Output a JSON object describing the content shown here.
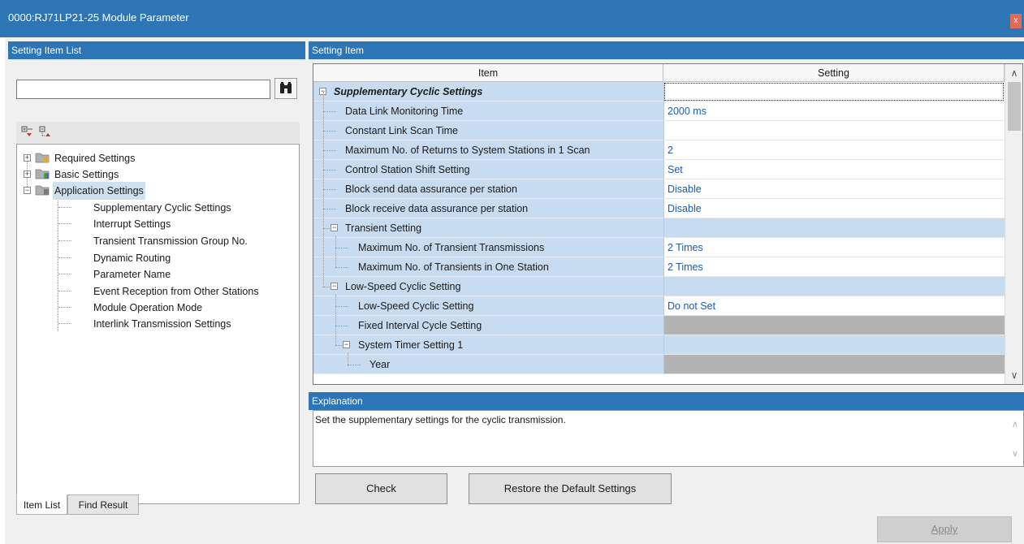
{
  "window": {
    "title": "0000:RJ71LP21-25 Module Parameter",
    "close_label": "x"
  },
  "left_panel": {
    "header": "Setting Item List",
    "search": {
      "value": "",
      "placeholder": ""
    },
    "tree": {
      "required": "Required Settings",
      "basic": "Basic Settings",
      "application": "Application Settings",
      "children": [
        "Supplementary Cyclic Settings",
        "Interrupt Settings",
        "Transient Transmission Group No.",
        "Dynamic Routing",
        "Parameter Name",
        "Event Reception from Other Stations",
        "Module Operation Mode",
        "Interlink Transmission Settings"
      ]
    },
    "tabs": [
      "Item List",
      "Find Result"
    ]
  },
  "grid_panel": {
    "header": "Setting Item",
    "columns": {
      "item": "Item",
      "setting": "Setting"
    },
    "rows": [
      {
        "item": "Supplementary Cyclic Settings",
        "setting": ""
      },
      {
        "item": "Data Link Monitoring Time",
        "setting": "2000 ms"
      },
      {
        "item": "Constant Link Scan Time",
        "setting": ""
      },
      {
        "item": "Maximum No. of Returns to System Stations in 1 Scan",
        "setting": "2"
      },
      {
        "item": "Control Station Shift Setting",
        "setting": "Set"
      },
      {
        "item": "Block send data assurance per station",
        "setting": "Disable"
      },
      {
        "item": "Block receive data assurance per station",
        "setting": "Disable"
      },
      {
        "item": "Transient Setting",
        "setting": ""
      },
      {
        "item": "Maximum No. of Transient Transmissions",
        "setting": "2 Times"
      },
      {
        "item": "Maximum No. of Transients in One Station",
        "setting": "2 Times"
      },
      {
        "item": "Low-Speed Cyclic Setting",
        "setting": ""
      },
      {
        "item": "Low-Speed Cyclic Setting",
        "setting": "Do not Set"
      },
      {
        "item": "Fixed Interval Cycle Setting",
        "setting": ""
      },
      {
        "item": "System Timer Setting 1",
        "setting": ""
      },
      {
        "item": "Year",
        "setting": ""
      }
    ]
  },
  "explanation": {
    "header": "Explanation",
    "text": "Set the supplementary settings for the cyclic transmission."
  },
  "buttons": {
    "check": "Check",
    "restore": "Restore the Default Settings",
    "apply": "Apply"
  },
  "colors": {
    "accent": "#2e75b6",
    "item_cell": "#c7dbf1",
    "setting_text": "#1e5aa8"
  },
  "icons": [
    "close-icon",
    "binoculars-icon",
    "expand-all-icon",
    "collapse-all-icon",
    "folder-icon",
    "scroll-up-icon",
    "scroll-down-icon"
  ]
}
